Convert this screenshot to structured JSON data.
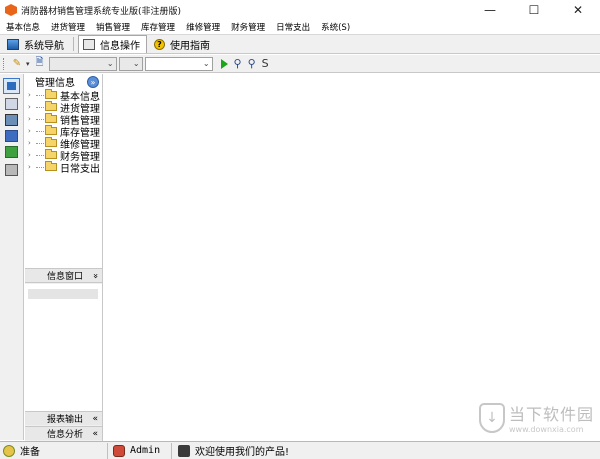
{
  "window": {
    "title": "消防器材销售管理系统专业版(非注册版)",
    "minimize": "—",
    "maximize": "☐",
    "close": "✕"
  },
  "menu": [
    "基本信息",
    "进货管理",
    "销售管理",
    "库存管理",
    "维修管理",
    "财务管理",
    "日常支出",
    "系统(S)"
  ],
  "tabs": [
    {
      "label": "系统导航",
      "icon": "navigation-icon"
    },
    {
      "label": "信息操作",
      "icon": "info-window-icon"
    },
    {
      "label": "使用指南",
      "icon": "help-icon"
    }
  ],
  "tree": {
    "header": "管理信息",
    "items": [
      "基本信息",
      "进货管理",
      "销售管理",
      "库存管理",
      "维修管理",
      "财务管理",
      "日常支出"
    ]
  },
  "subpanel": {
    "title": "信息窗口",
    "report": "报表输出",
    "analysis": "信息分析",
    "collapse_glyph": "»",
    "expand_glyph": "«"
  },
  "statusbar": {
    "ready": "准备",
    "user": "Admin",
    "welcome": "欢迎使用我们的产品!"
  },
  "watermark": {
    "brand": "当下软件园",
    "url": "www.downxia.com"
  }
}
